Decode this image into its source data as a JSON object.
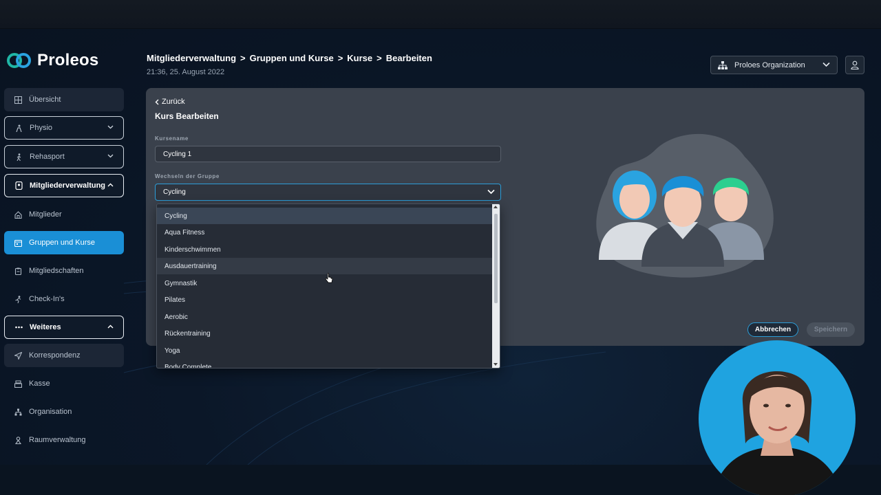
{
  "app": {
    "name": "Proleos"
  },
  "sidebar": {
    "items": [
      {
        "label": "Übersicht",
        "icon": "grid-icon"
      },
      {
        "label": "Physio",
        "icon": "physio-icon"
      },
      {
        "label": "Rehasport",
        "icon": "walking-icon"
      },
      {
        "label": "Mitgliederverwaltung",
        "icon": "member-card-icon"
      },
      {
        "label": "Mitglieder",
        "icon": "home-icon"
      },
      {
        "label": "Gruppen und Kurse",
        "icon": "calendar-icon"
      },
      {
        "label": "Mitgliedschaften",
        "icon": "clipboard-icon"
      },
      {
        "label": "Check-In's",
        "icon": "run-icon"
      },
      {
        "label": "Weiteres",
        "icon": "more-icon"
      },
      {
        "label": "Korrespondenz",
        "icon": "send-icon"
      },
      {
        "label": "Kasse",
        "icon": "register-icon"
      },
      {
        "label": "Organisation",
        "icon": "org-icon"
      },
      {
        "label": "Raumverwaltung",
        "icon": "room-icon"
      }
    ]
  },
  "header": {
    "breadcrumb": [
      "Mitgliederverwaltung",
      "Gruppen und Kurse",
      "Kurse",
      "Bearbeiten"
    ],
    "timestamp": "21:36, 25. August 2022",
    "organization": "Proloes Organization"
  },
  "form": {
    "back_label": "Zurück",
    "title": "Kurs Bearbeiten",
    "course_name_label": "Kursename",
    "course_name_value": "Cycling 1",
    "group_label": "Wechseln der Gruppe",
    "group_value": "Cycling",
    "cancel_label": "Abbrechen",
    "save_label": "Speichern"
  },
  "dropdown": {
    "options": [
      "Cycling",
      "Aqua Fitness",
      "Kinderschwimmen",
      "Ausdauertraining",
      "Gymnastik",
      "Pilates",
      "Aerobic",
      "Rückentraining",
      "Yoga",
      "Body Complete"
    ],
    "selected": "Cycling",
    "hovered": "Ausdauertraining"
  },
  "colors": {
    "accent": "#1a8fd6",
    "focus_border": "#2c9ed9",
    "card_bg": "#3a414c",
    "presenter_bg": "#1fa3e0"
  }
}
